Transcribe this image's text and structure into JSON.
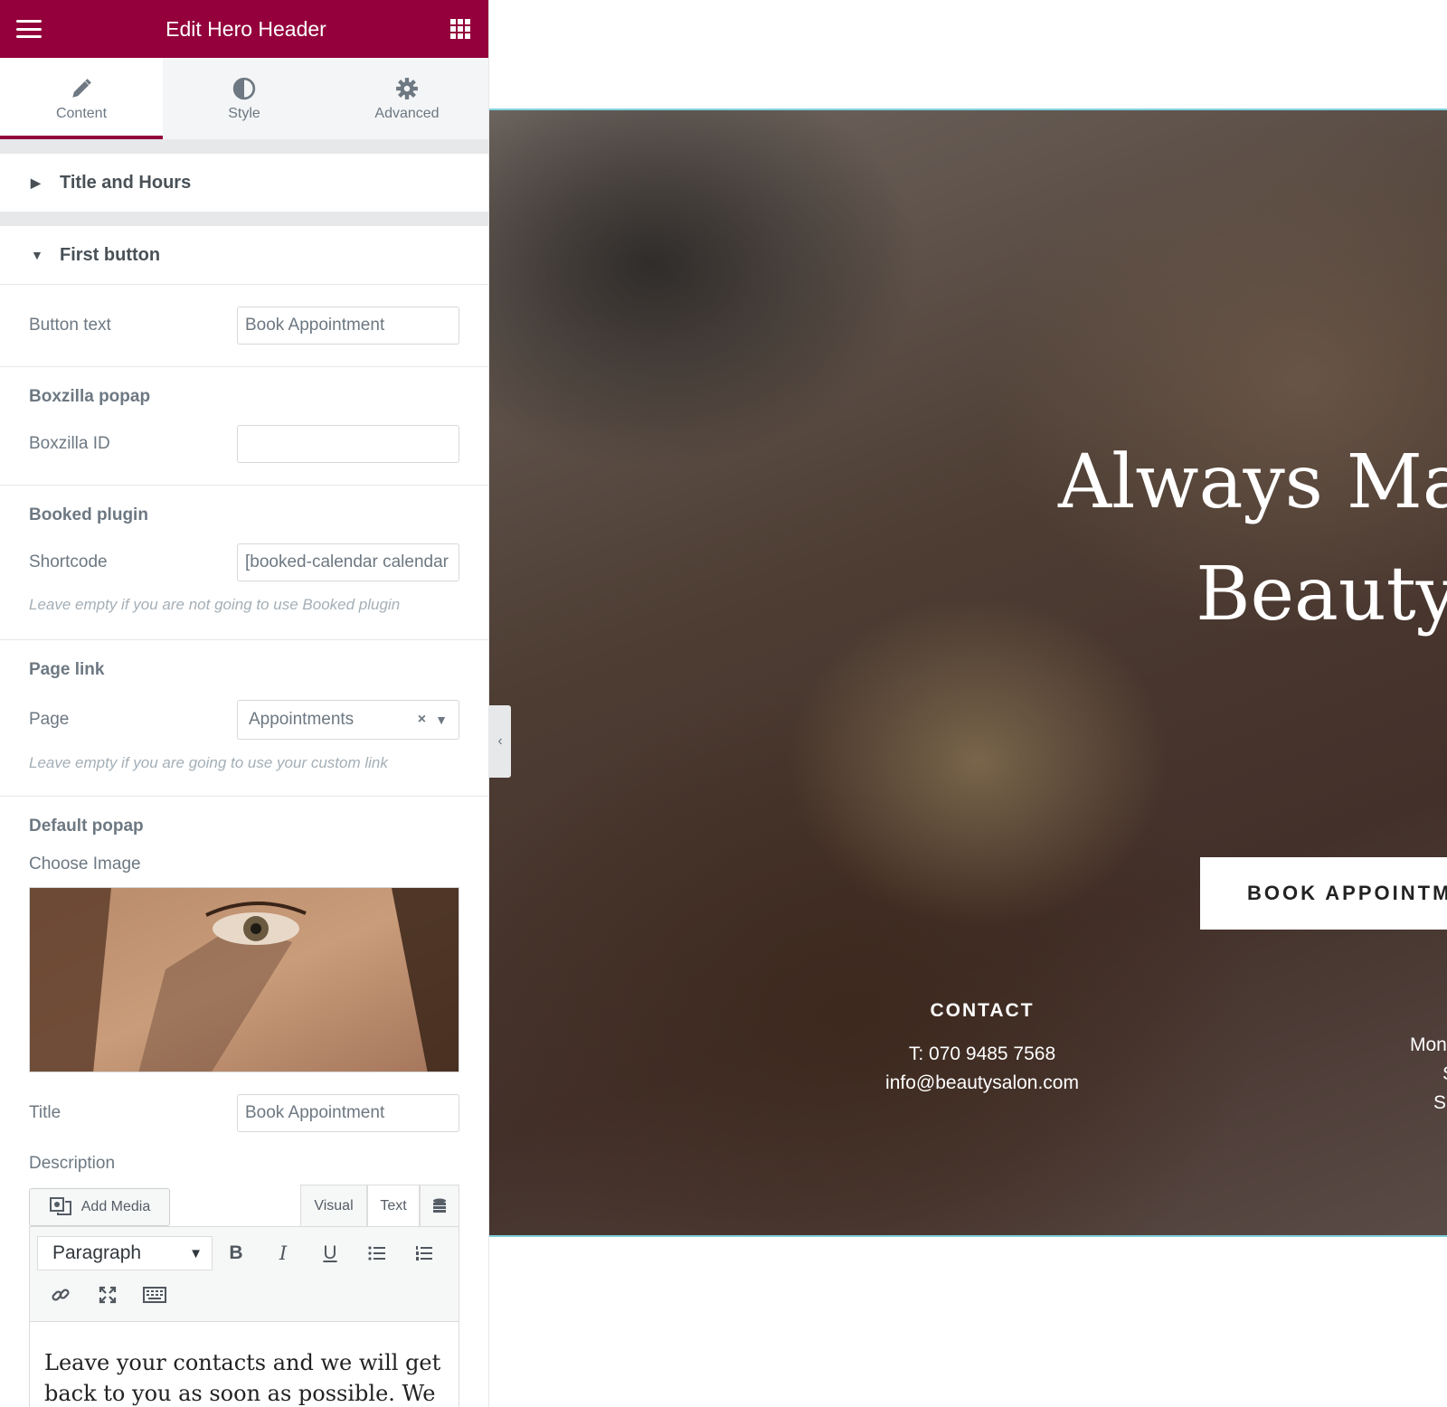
{
  "header": {
    "title": "Edit Hero Header"
  },
  "tabs": [
    {
      "label": "Content",
      "icon": "pencil-icon"
    },
    {
      "label": "Style",
      "icon": "contrast-icon"
    },
    {
      "label": "Advanced",
      "icon": "gear-icon"
    }
  ],
  "sections": {
    "title_hours": {
      "label": "Title and Hours",
      "expanded": false
    },
    "first_button": {
      "label": "First button",
      "expanded": true
    }
  },
  "fields": {
    "button_text": {
      "label": "Button text",
      "value": "Book Appointment"
    },
    "boxzilla_heading": "Boxzilla popap",
    "boxzilla_id": {
      "label": "Boxzilla ID",
      "value": ""
    },
    "booked_heading": "Booked plugin",
    "shortcode": {
      "label": "Shortcode",
      "value": "[booked-calendar calendar"
    },
    "shortcode_note": "Leave empty if you are not going to use Booked plugin",
    "page_link_heading": "Page link",
    "page": {
      "label": "Page",
      "value": "Appointments"
    },
    "page_note": "Leave empty if you are going to use your custom link",
    "default_popap_heading": "Default popap",
    "choose_image_label": "Choose Image",
    "title": {
      "label": "Title",
      "value": "Book Appointment"
    },
    "description_label": "Description"
  },
  "editor": {
    "add_media": "Add Media",
    "mode_tabs": [
      "Visual",
      "Text"
    ],
    "format_select": "Paragraph",
    "content": "Leave your contacts and we will get back to you as soon as possible. We made a schedule"
  },
  "preview": {
    "hero_title_line1": "Always Make",
    "hero_title_line2": "Beauty",
    "book_button": "BOOK APPOINTMENT",
    "contact_heading": "CONTACT",
    "contact_phone": "T: 070 9485 7568",
    "contact_email": "info@beautysalon.com",
    "hours_lines": [
      "Mon",
      "S",
      "Su"
    ]
  },
  "colors": {
    "brand": "#93003c",
    "accent_border": "#7fd1dd"
  }
}
